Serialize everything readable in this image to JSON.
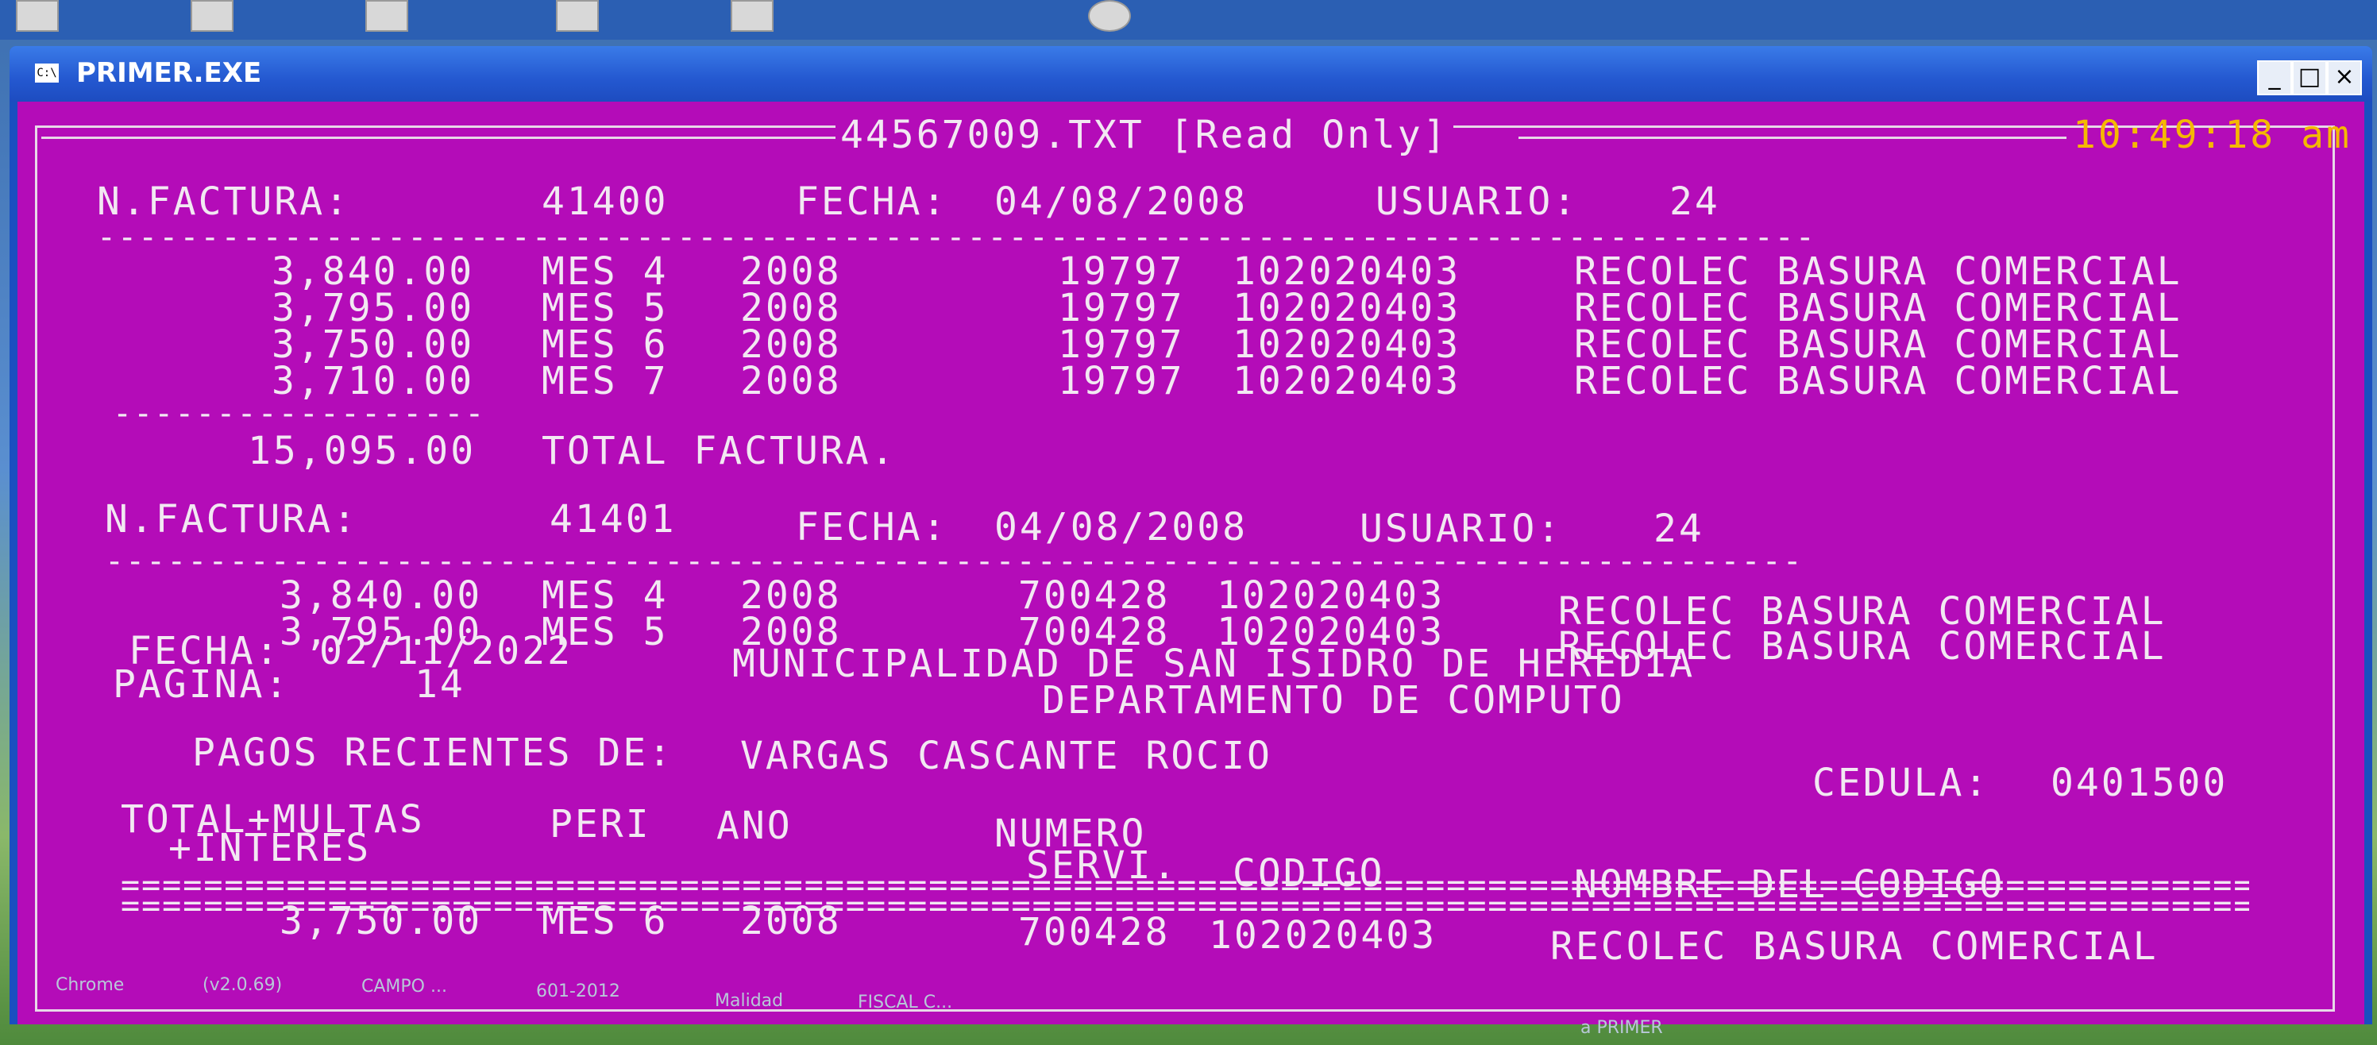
{
  "window": {
    "title": "PRIMER.EXE"
  },
  "console": {
    "file_header": "44567009.TXT [Read Only]",
    "clock": "10:49:18 am",
    "invoices": [
      {
        "label": "N.FACTURA:",
        "number": "41400",
        "fecha_label": "FECHA:",
        "fecha": "04/08/2008",
        "usuario_label": "USUARIO:",
        "usuario": "24",
        "lines": [
          {
            "amount": "3,840.00",
            "mes": "MES 4",
            "year": "2008",
            "servicio": "19797",
            "codigo": "102020403",
            "desc": "RECOLEC BASURA COMERCIAL"
          },
          {
            "amount": "3,795.00",
            "mes": "MES 5",
            "year": "2008",
            "servicio": "19797",
            "codigo": "102020403",
            "desc": "RECOLEC BASURA COMERCIAL"
          },
          {
            "amount": "3,750.00",
            "mes": "MES 6",
            "year": "2008",
            "servicio": "19797",
            "codigo": "102020403",
            "desc": "RECOLEC BASURA COMERCIAL"
          },
          {
            "amount": "3,710.00",
            "mes": "MES 7",
            "year": "2008",
            "servicio": "19797",
            "codigo": "102020403",
            "desc": "RECOLEC BASURA COMERCIAL"
          }
        ],
        "total": "15,095.00",
        "total_label": "TOTAL FACTURA."
      },
      {
        "label": "N.FACTURA:",
        "number": "41401",
        "fecha_label": "FECHA:",
        "fecha": "04/08/2008",
        "usuario_label": "USUARIO:",
        "usuario": "24",
        "lines": [
          {
            "amount": "3,840.00",
            "mes": "MES 4",
            "year": "2008",
            "servicio": "700428",
            "codigo": "102020403",
            "desc": "RECOLEC BASURA COMERCIAL"
          },
          {
            "amount": "3,795.00",
            "mes": "MES 5",
            "year": "2008",
            "servicio": "700428",
            "codigo": "102020403",
            "desc": "RECOLEC BASURA COMERCIAL"
          }
        ]
      }
    ],
    "report": {
      "fecha_label": "FECHA:",
      "fecha": "02/11/2022",
      "pagina_label": "PAGINA:",
      "pagina": "14",
      "org": "MUNICIPALIDAD DE SAN ISIDRO DE HEREDIA",
      "dept": "DEPARTAMENTO DE COMPUTO",
      "pagos_label": "PAGOS RECIENTES DE:",
      "pagos_name": "VARGAS CASCANTE ROCIO",
      "cedula_label": "CEDULA:",
      "cedula": "0401500",
      "col_total": "TOTAL+MULTAS",
      "col_interes": "+INTERES",
      "col_peri": "PERI",
      "col_ano": "ANO",
      "col_numero": "NUMERO",
      "col_servi": "SERVI.",
      "col_codigo": "CODIGO",
      "col_nombre": "NOMBRE DEL CODIGO",
      "row": {
        "amount": "3,750.00",
        "mes": "MES 6",
        "year": "2008",
        "servicio": "700428",
        "codigo": "102020403",
        "desc": "RECOLEC BASURA COMERCIAL"
      }
    }
  },
  "desktop": {
    "bottom_labels": [
      "Chrome",
      "(v2.0.69)",
      "CAMPO ...",
      "601-2012",
      "Malidad",
      "FISCAL C...",
      "a PRIMER"
    ]
  }
}
